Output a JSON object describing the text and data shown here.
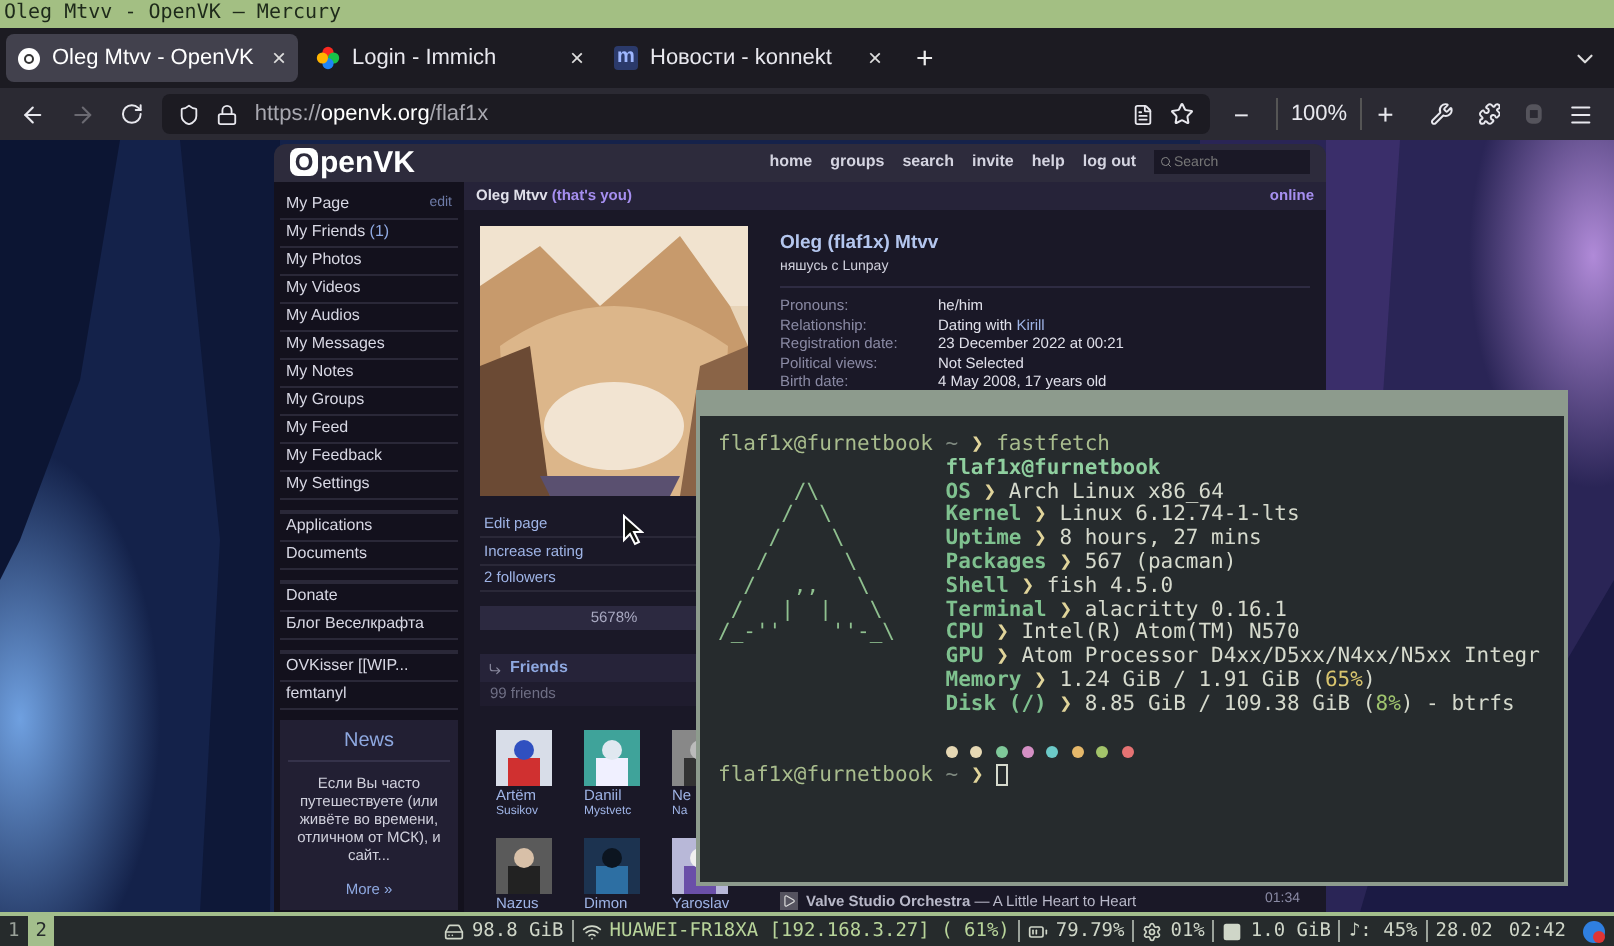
{
  "window": {
    "title": "Oleg Mtvv - OpenVK — Mercury"
  },
  "tabs": [
    {
      "label": "Oleg Mtvv - OpenVK",
      "selected": true,
      "close": "×",
      "kind": "ring"
    },
    {
      "label": "Login - Immich",
      "selected": false,
      "close": "×",
      "kind": "pinwheel"
    },
    {
      "label": "Новости - konnekt",
      "selected": false,
      "close": "×",
      "kind": "letter",
      "glyph": "m"
    }
  ],
  "new_tab": "+",
  "toolbar": {
    "forward_disabled": true,
    "url": {
      "scheme": "https://",
      "domain": "openvk.org",
      "path": "/flaf1x"
    },
    "zoom_out": "−",
    "zoom": "100%",
    "zoom_in": "+"
  },
  "site": {
    "logo": {
      "mark": "O",
      "text": "penVK"
    },
    "nav": [
      "home",
      "groups",
      "search",
      "invite",
      "help",
      "log out"
    ],
    "search": {
      "placeholder": "Search"
    }
  },
  "sidebar": {
    "groups": [
      [
        {
          "label": "My Page",
          "action": "edit"
        },
        {
          "label": "My Friends",
          "count": "(1)"
        },
        {
          "label": "My Photos"
        },
        {
          "label": "My Videos"
        },
        {
          "label": "My Audios"
        },
        {
          "label": "My Messages"
        },
        {
          "label": "My Notes"
        },
        {
          "label": "My Groups"
        },
        {
          "label": "My Feed"
        },
        {
          "label": "My Feedback"
        },
        {
          "label": "My Settings"
        }
      ],
      [
        {
          "label": "Applications"
        },
        {
          "label": "Documents"
        }
      ],
      [
        {
          "label": "Donate"
        },
        {
          "label": "Блог Веселкрафта"
        }
      ],
      [
        {
          "label": "OVKisser [[WIP..."
        },
        {
          "label": "femtanyl"
        }
      ]
    ],
    "news": {
      "title": "News",
      "text": "Если Вы часто путешествуете (или живёте во времени, отличном от МСК), и сайт...",
      "more": "More »"
    }
  },
  "profile": {
    "header": {
      "name": "Oleg Mtvv",
      "note": "(that's you)",
      "status": "online"
    },
    "name": "Oleg (flaf1x) Mtvv",
    "status_text": "няшусь с Lunpay",
    "fields": [
      {
        "label": "Pronouns:",
        "value": "he/him"
      },
      {
        "label": "Relationship:",
        "value": "Dating with ",
        "link": "Kirill"
      },
      {
        "label": "Registration date:",
        "value": "23 December 2022 at 00:21"
      },
      {
        "label": "Political views:",
        "value": "Not Selected"
      },
      {
        "label": "Birth date:",
        "value": "4 May 2008, 17 years old"
      }
    ],
    "actions": [
      "Edit page",
      "Increase rating",
      "2 followers"
    ],
    "rating": "5678%",
    "friends": {
      "title": "Friends",
      "count": "99 friends",
      "items": [
        {
          "first": "Artëm",
          "last": "Susikov"
        },
        {
          "first": "Daniil",
          "last": "Mystvetc"
        },
        {
          "first": "Ne",
          "last": "Na"
        },
        {
          "first": "Nazus"
        },
        {
          "first": "Dimon"
        },
        {
          "first": "Yaroslav"
        }
      ]
    },
    "player": {
      "track": "**Valve Studio Orchestra** — A Little Heart to Heart",
      "time": "01:34"
    }
  },
  "terminal": {
    "prompt": {
      "user": "flaf1x@furnetbook",
      "path": "~",
      "arrow": "❯",
      "command": "fastfetch"
    },
    "art": [
      "      /\\",
      "     /  \\",
      "    /    \\",
      "   /      \\",
      "  /   ,,   \\",
      " /   |  |   \\",
      "/_-''    ''-_\\"
    ],
    "title": "flaf1x@furnetbook",
    "fields": [
      {
        "label": "OS",
        "sep": "❯",
        "value": "Arch Linux x86_64"
      },
      {
        "label": "Kernel",
        "sep": "❯",
        "value": "Linux 6.12.74-1-lts"
      },
      {
        "label": "Uptime",
        "sep": "❯",
        "value": "8 hours, 27 mins"
      },
      {
        "label": "Packages",
        "sep": "❯",
        "value": "567 (pacman)"
      },
      {
        "label": "Shell",
        "sep": "❯",
        "value": "fish 4.5.0"
      },
      {
        "label": "Terminal",
        "sep": "❯",
        "value": "alacritty 0.16.1"
      },
      {
        "label": "CPU",
        "sep": "❯",
        "value": "Intel(R) Atom(TM) N570"
      },
      {
        "label": "GPU",
        "sep": "❯",
        "value": "Atom Processor D4xx/D5xx/N4xx/N5xx Integr"
      },
      {
        "label": "Memory",
        "sep": "❯",
        "value": "1.24 GiB / 1.91 GiB (",
        "percent": "65%",
        "color": "#d9c56e",
        "tail": ")"
      },
      {
        "label": "Disk (/)",
        "sep": "❯",
        "value": "8.85 GiB / 109.38 GiB (",
        "percent": "8%",
        "color": "#9fc46e",
        "tail": ") - btrfs"
      }
    ],
    "palette": [
      {
        "color": "#e6d8b4"
      },
      {
        "color": "#e6d8b4"
      },
      {
        "color": "#7fc99a"
      },
      {
        "color": "#d48fc4"
      },
      {
        "color": "#6ccac8"
      },
      {
        "color": "#e5b86a"
      },
      {
        "color": "#a3c46a"
      },
      {
        "color": "#e57373"
      }
    ],
    "prompt2": {
      "user": "flaf1x@furnetbook",
      "path": "~",
      "arrow": "❯"
    }
  },
  "status_bar": {
    "workspaces": [
      {
        "label": "1",
        "selected": false
      },
      {
        "label": "2",
        "selected": true
      }
    ],
    "items": [
      {
        "kind": "disk",
        "text": "98.8 GiB",
        "divider_after": true
      },
      {
        "kind": "wifi",
        "text": "HUAWEI-FR18XA [192.168.3.27] ( 61%)",
        "divider_after": true
      },
      {
        "kind": "battery",
        "text": "79.79%",
        "divider_after": true
      },
      {
        "kind": "cpu",
        "text": "01%",
        "divider_after": true
      },
      {
        "kind": "memory",
        "text": "1.0 GiB",
        "divider_after": true
      },
      {
        "kind": "plain",
        "text": "♪: 45%",
        "divider_after": true
      },
      {
        "kind": "plain",
        "text": "28.02",
        "divider_after": false
      },
      {
        "kind": "plain",
        "text": "02:42",
        "divider_after": false
      }
    ]
  }
}
